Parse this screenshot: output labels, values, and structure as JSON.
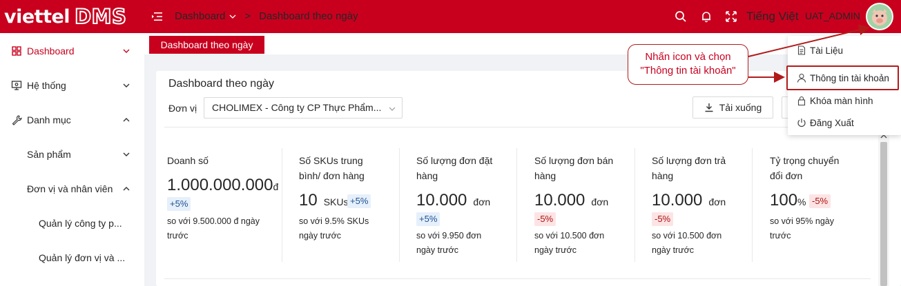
{
  "header": {
    "logo_main": "viettel",
    "logo_sub": "DMS",
    "breadcrumb": [
      "Dashboard",
      "Dashboard theo ngày"
    ],
    "language": "Tiếng Việt",
    "username": "UAT_ADMIN",
    "brand_color": "#c8001e",
    "icons": [
      "menu-fold-icon",
      "search-icon",
      "bell-icon",
      "fullscreen-icon",
      "avatar"
    ]
  },
  "sidebar": {
    "items": [
      {
        "label": "Dashboard",
        "icon": "dashboard-icon",
        "active": true
      },
      {
        "label": "Hệ thống",
        "icon": "monitor-icon"
      },
      {
        "label": "Danh mục",
        "icon": "wrench-icon"
      },
      {
        "label": "Sản phẩm"
      },
      {
        "label": "Đơn vị và nhân viên"
      },
      {
        "label": "Quản lý công ty p..."
      },
      {
        "label": "Quản lý đơn vị và ..."
      }
    ]
  },
  "tabs": {
    "active": "Dashboard theo ngày"
  },
  "main": {
    "title": "Dashboard theo ngày",
    "unit_label": "Đơn vị",
    "unit_value": "CHOLIMEX - Công ty CP Thực Phẩm...",
    "download_label": "Tải xuống"
  },
  "stats": [
    {
      "title_lines": [
        "Doanh số"
      ],
      "value": "1.000.000.000",
      "unit": "đ",
      "badge": "+5%",
      "trend": "up",
      "compare_lines": [
        "so với 9.500.000 đ ngày",
        "trước"
      ]
    },
    {
      "title_lines": [
        "Số SKUs trung",
        "bình/ đơn hàng"
      ],
      "value": "10",
      "unit": "SKUs",
      "badge": "+5%",
      "trend": "up",
      "compare_lines": [
        "so với 9.5% SKUs",
        "ngày trước"
      ]
    },
    {
      "title_lines": [
        "Số lượng đơn đặt",
        "hàng"
      ],
      "value": "10.000",
      "unit": "đơn",
      "badge": "+5%",
      "trend": "up",
      "compare_lines": [
        "so với 9.950 đơn",
        "ngày trước"
      ]
    },
    {
      "title_lines": [
        "Số lượng đơn bán",
        "hàng"
      ],
      "value": "10.000",
      "unit": "đơn",
      "badge": "-5%",
      "trend": "down",
      "compare_lines": [
        "so với 10.500 đơn",
        "ngày trước"
      ]
    },
    {
      "title_lines": [
        "Số lượng đơn trả",
        "hàng"
      ],
      "value": "10.000",
      "unit": "đơn",
      "badge": "-5%",
      "trend": "down",
      "compare_lines": [
        "so với 10.500 đơn",
        "ngày trước"
      ]
    },
    {
      "title_lines": [
        "Tỷ trọng chuyển",
        "đổi đơn"
      ],
      "value": "100",
      "unit": "%",
      "badge": "-5%",
      "trend": "down",
      "compare_lines": [
        "so với 95% ngày",
        "trước"
      ]
    }
  ],
  "user_menu": {
    "items": [
      {
        "label": "Tài Liệu",
        "icon": "document-icon"
      },
      {
        "label": "Thông tin tài khoản",
        "icon": "user-icon",
        "highlighted": true
      },
      {
        "label": "Khóa màn hình",
        "icon": "lock-icon"
      },
      {
        "label": "Đăng Xuất",
        "icon": "power-icon"
      }
    ]
  },
  "callout": {
    "line1": "Nhấn icon và chọn",
    "line2": "\"Thông tin tài khoản\""
  }
}
